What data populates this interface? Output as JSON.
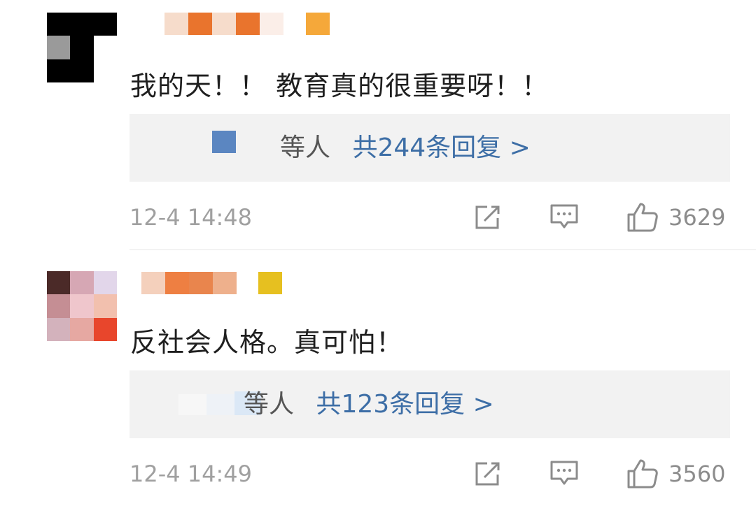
{
  "comments": [
    {
      "text": "我的天！！ 教育真的很重要呀！！",
      "reply_suffix": "等人",
      "reply_link": "共244条回复 >",
      "timestamp": "12-4 14:48",
      "likes": "3629",
      "badge_color": "#f5a83a"
    },
    {
      "text": "反社会人格。真可怕！",
      "reply_suffix": "等人",
      "reply_link": "共123条回复 >",
      "timestamp": "12-4 14:49",
      "likes": "3560",
      "badge_color": "#e6c020"
    }
  ],
  "icons": {
    "share": "share-icon",
    "comment": "comment-icon",
    "like": "thumbs-up-icon"
  },
  "colors": {
    "link": "#3d6ea6",
    "text": "#1f1f1f",
    "meta": "#a0a0a0",
    "reply_bg": "#f2f2f2"
  }
}
